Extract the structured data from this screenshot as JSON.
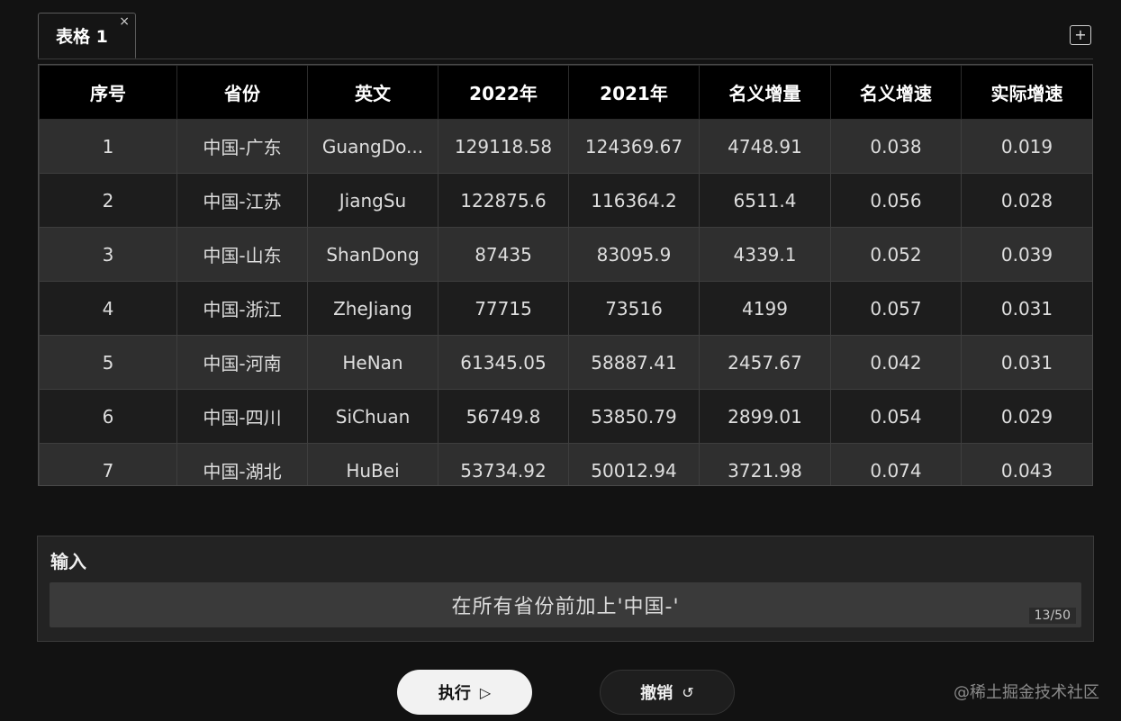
{
  "tabs": [
    {
      "label": "表格 1",
      "close": "×"
    }
  ],
  "add_tab": "+",
  "table": {
    "columns": [
      "序号",
      "省份",
      "英文",
      "2022年",
      "2021年",
      "名义增量",
      "名义增速",
      "实际增速"
    ],
    "rows": [
      [
        "1",
        "中国-广东",
        "GuangDo...",
        "129118.58",
        "124369.67",
        "4748.91",
        "0.038",
        "0.019"
      ],
      [
        "2",
        "中国-江苏",
        "JiangSu",
        "122875.6",
        "116364.2",
        "6511.4",
        "0.056",
        "0.028"
      ],
      [
        "3",
        "中国-山东",
        "ShanDong",
        "87435",
        "83095.9",
        "4339.1",
        "0.052",
        "0.039"
      ],
      [
        "4",
        "中国-浙江",
        "ZheJiang",
        "77715",
        "73516",
        "4199",
        "0.057",
        "0.031"
      ],
      [
        "5",
        "中国-河南",
        "HeNan",
        "61345.05",
        "58887.41",
        "2457.67",
        "0.042",
        "0.031"
      ],
      [
        "6",
        "中国-四川",
        "SiChuan",
        "56749.8",
        "53850.79",
        "2899.01",
        "0.054",
        "0.029"
      ],
      [
        "7",
        "中国-湖北",
        "HuBei",
        "53734.92",
        "50012.94",
        "3721.98",
        "0.074",
        "0.043"
      ]
    ]
  },
  "input": {
    "title": "输入",
    "value": "在所有省份前加上'中国-'",
    "counter": "13/50"
  },
  "buttons": {
    "execute": {
      "label": "执行",
      "icon": "▷",
      "icon_name": "play-icon"
    },
    "undo": {
      "label": "撤销",
      "icon": "↺",
      "icon_name": "undo-icon"
    }
  },
  "watermark": "@稀土掘金技术社区",
  "colors": {
    "background": "#121212",
    "header": "#000000",
    "row_odd": "#2f2f2f",
    "row_even": "#1d1d1d"
  }
}
